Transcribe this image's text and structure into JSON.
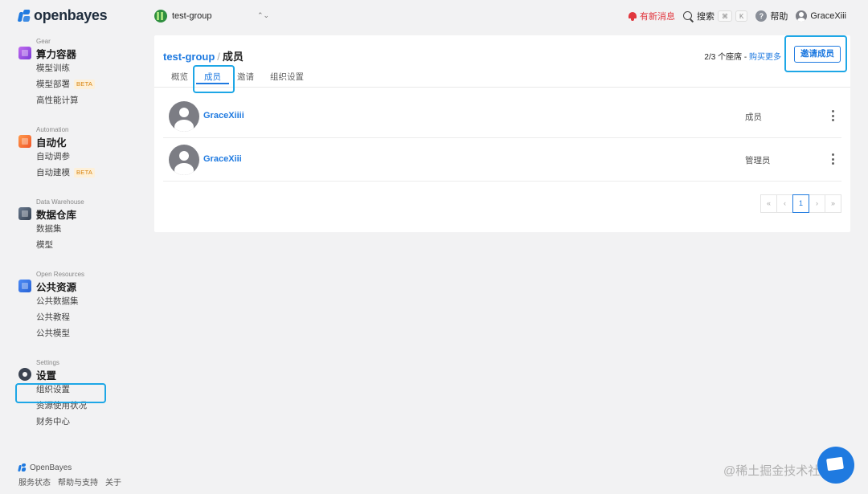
{
  "brand": {
    "name": "openbayes"
  },
  "topbar": {
    "group_name": "test-group",
    "caret": "⌃⌄",
    "notifications_label": "有新消息",
    "search_label": "搜索",
    "shortcut_cmd": "⌘",
    "shortcut_key": "K",
    "help_label": "帮助",
    "help_glyph": "?",
    "user_name": "GraceXiii"
  },
  "sidebar": {
    "sections": [
      {
        "eyebrow": "Gear",
        "title": "算力容器",
        "icon": "gear-cube-icon",
        "items": [
          {
            "label": "模型训练"
          },
          {
            "label": "模型部署",
            "badge": "BETA"
          },
          {
            "label": "高性能计算"
          }
        ]
      },
      {
        "eyebrow": "Automation",
        "title": "自动化",
        "icon": "automation-icon",
        "items": [
          {
            "label": "自动调参"
          },
          {
            "label": "自动建模",
            "badge": "BETA"
          }
        ]
      },
      {
        "eyebrow": "Data Warehouse",
        "title": "数据仓库",
        "icon": "data-warehouse-icon",
        "items": [
          {
            "label": "数据集"
          },
          {
            "label": "模型"
          }
        ]
      },
      {
        "eyebrow": "Open Resources",
        "title": "公共资源",
        "icon": "open-resources-icon",
        "items": [
          {
            "label": "公共数据集"
          },
          {
            "label": "公共教程"
          },
          {
            "label": "公共模型"
          }
        ]
      },
      {
        "eyebrow": "Settings",
        "title": "设置",
        "icon": "settings-gear-icon",
        "items": [
          {
            "label": "组织设置"
          },
          {
            "label": "资源使用状况"
          },
          {
            "label": "财务中心"
          }
        ]
      }
    ],
    "footer": {
      "brand": "OpenBayes",
      "links": [
        "服务状态",
        "帮助与支持",
        "关于"
      ]
    }
  },
  "main": {
    "breadcrumb": {
      "group": "test-group",
      "separator": "/",
      "current": "成员"
    },
    "seats": {
      "text": "2/3 个座席 - ",
      "buy_label": "购买更多"
    },
    "invite_button": "邀请成员",
    "tabs": [
      {
        "label": "概览"
      },
      {
        "label": "成员",
        "active": true
      },
      {
        "label": "邀请"
      },
      {
        "label": "组织设置"
      }
    ],
    "members": [
      {
        "name": "GraceXiiii",
        "role": "成员"
      },
      {
        "name": "GraceXiii",
        "role": "管理员"
      }
    ],
    "pagination": {
      "first": "«",
      "prev": "‹",
      "current": "1",
      "next": "›",
      "last": "»"
    }
  },
  "watermark": "@稀土掘金技术社区",
  "colors": {
    "accent": "#1f7ae0",
    "highlight": "#1ea7e6",
    "alert": "#e1373e"
  }
}
